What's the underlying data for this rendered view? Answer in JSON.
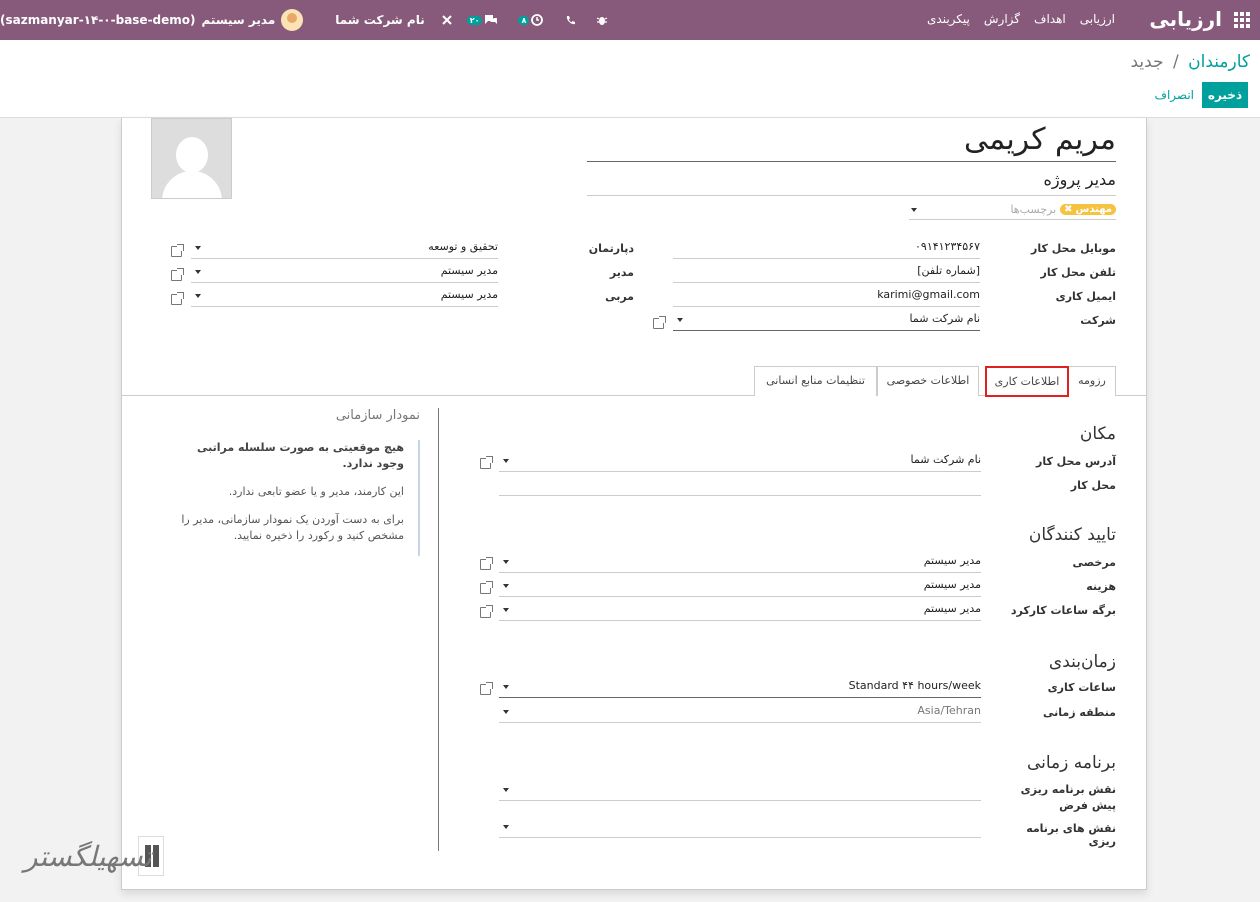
{
  "navbar": {
    "app_title": "ارزیابی",
    "menu": [
      "ارزیابی",
      "اهداف",
      "گزارش",
      "پیکربندی"
    ],
    "company": "نام شرکت شما",
    "chat_count": "۲۰",
    "activity_count": "۸",
    "user": "مدیر سیستم",
    "database": "(sazmanyar-۱۴-۰-base-demo)"
  },
  "breadcrumb": {
    "parent": "کارمندان",
    "separator": "/",
    "current": "جدید"
  },
  "actions": {
    "save": "ذخیره",
    "discard": "انصراف"
  },
  "employee": {
    "name": "مریم کریمی",
    "job_title": "مدیر پروژه",
    "tag": "مهندس",
    "tags_placeholder": "برچسب‌ها"
  },
  "fields_right": [
    {
      "label": "موبایل محل کار",
      "value": "۰۹۱۴۱۲۳۴۵۶۷"
    },
    {
      "label": "تلفن محل کار",
      "value": "[شماره تلفن]"
    },
    {
      "label": "ایمیل کاری",
      "value": "karimi@gmail.com"
    },
    {
      "label": "شرکت",
      "value": "نام شرکت شما"
    }
  ],
  "fields_left": [
    {
      "label": "دپارتمان",
      "value": "تحقیق و توسعه"
    },
    {
      "label": "مدیر",
      "value": "مدیر سیستم"
    },
    {
      "label": "مربی",
      "value": "مدیر سیستم"
    }
  ],
  "tabs": [
    "رزومه",
    "اطلاعات کاری",
    "اطلاعات خصوصی",
    "تنظیمات منابع انسانی"
  ],
  "work_info": {
    "location": {
      "title": "مکان",
      "address_label": "آدرس محل کار",
      "address_value": "نام شرکت شما",
      "work_location_label": "محل کار",
      "work_location_value": ""
    },
    "approvers": {
      "title": "تایید کنندگان",
      "rows": [
        {
          "label": "مرخصی",
          "value": "مدیر سیستم"
        },
        {
          "label": "هزینه",
          "value": "مدیر سیستم"
        },
        {
          "label": "برگه ساعات کارکرد",
          "value": "مدیر سیستم"
        }
      ]
    },
    "schedule": {
      "title": "زمان‌بندی",
      "hours_label": "ساعات کاری",
      "hours_value": "Standard ۴۴ hours/week",
      "timezone_label": "منطقه زمانی",
      "timezone_value": "Asia/Tehran"
    },
    "planning": {
      "title": "برنامه زمانی",
      "default_role_label": "نقش برنامه ریزی پیش فرض",
      "roles_label": "نقش های برنامه ریزی"
    }
  },
  "org_chart": {
    "title": "نمودار سازمانی",
    "heading": "هیچ موقعیتی به صورت سلسله مراتبی وجود ندارد.",
    "line1": "این کارمند، مدیر و یا عضو تابعی ندارد.",
    "line2": "برای به دست آوردن یک نمودار سازمانی، مدیر را مشخص کنید و رکورد را ذخیره نمایید."
  }
}
